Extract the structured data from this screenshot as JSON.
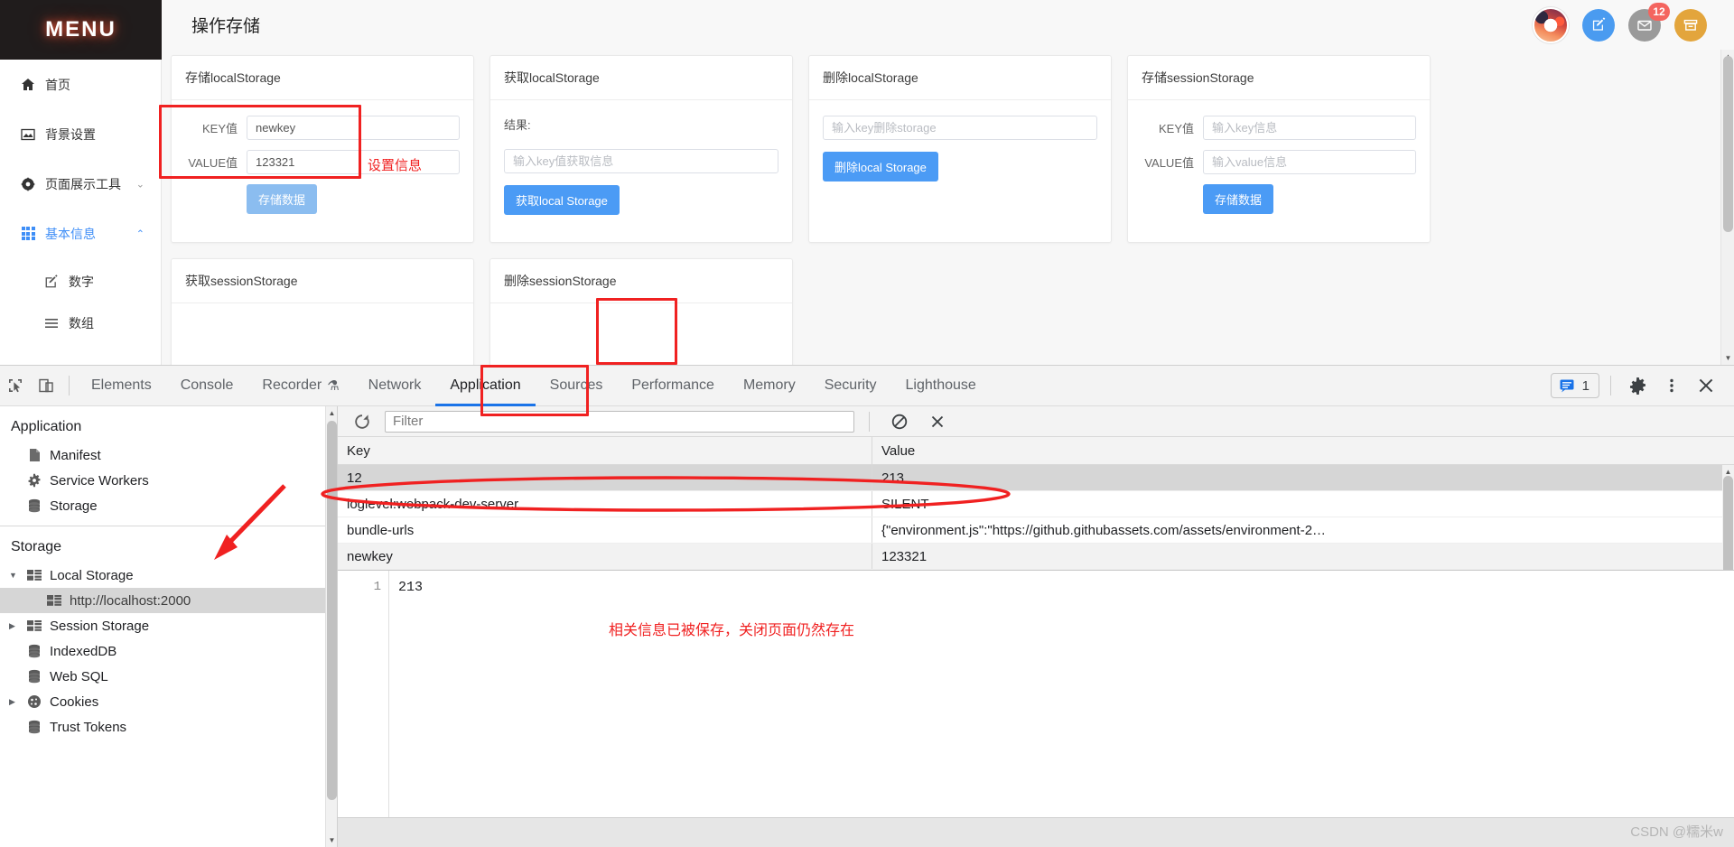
{
  "app": {
    "menu_label": "MENU",
    "page_title": "操作存储",
    "sidebar": [
      {
        "label": "首页",
        "icon": "home-icon",
        "kind": "top"
      },
      {
        "label": "背景设置",
        "icon": "image-icon",
        "kind": "top"
      },
      {
        "label": "页面展示工具",
        "icon": "compass-icon",
        "kind": "group",
        "caret": "⌄"
      },
      {
        "label": "基本信息",
        "icon": "grid-icon",
        "kind": "group-active",
        "caret": "⌃"
      },
      {
        "label": "数字",
        "icon": "edit-square-icon",
        "kind": "sub"
      },
      {
        "label": "数组",
        "icon": "list-icon",
        "kind": "sub"
      }
    ],
    "topbar_actions": [
      {
        "name": "avatar",
        "label": ""
      },
      {
        "name": "edit-button",
        "glyph": "✎",
        "color": "#4a9bf0"
      },
      {
        "name": "mail-button",
        "glyph": "✉",
        "color": "#9a9a9a",
        "badge": "12"
      },
      {
        "name": "archive-button",
        "glyph": "🗃",
        "color": "#e3a53c"
      }
    ],
    "cards": {
      "store_local": {
        "title": "存储localStorage",
        "key_label": "KEY值",
        "key_value": "newkey",
        "value_label": "VALUE值",
        "value_value": "123321",
        "submit_label": "存储数据"
      },
      "get_local": {
        "title": "获取localStorage",
        "result_label": "结果:",
        "input_placeholder": "输入key值获取信息",
        "submit_label": "获取local Storage"
      },
      "del_local": {
        "title": "删除localStorage",
        "input_placeholder": "输入key删除storage",
        "submit_label": "删除local Storage"
      },
      "store_session": {
        "title": "存储sessionStorage",
        "key_label": "KEY值",
        "key_placeholder": "输入key信息",
        "value_label": "VALUE值",
        "value_placeholder": "输入value信息",
        "submit_label": "存储数据"
      },
      "get_session": {
        "title": "获取sessionStorage"
      },
      "del_session": {
        "title": "删除sessionStorage"
      }
    },
    "annotation_set_info": "设置信息"
  },
  "devtools": {
    "tabs": [
      {
        "label": "Elements",
        "selected": false
      },
      {
        "label": "Console",
        "selected": false
      },
      {
        "label": "Recorder",
        "selected": false,
        "suffix": "⚗"
      },
      {
        "label": "Network",
        "selected": false
      },
      {
        "label": "Application",
        "selected": true
      },
      {
        "label": "Sources",
        "selected": false
      },
      {
        "label": "Performance",
        "selected": false
      },
      {
        "label": "Memory",
        "selected": false
      },
      {
        "label": "Security",
        "selected": false
      },
      {
        "label": "Lighthouse",
        "selected": false
      }
    ],
    "message_count": "1",
    "panel": {
      "application_title": "Application",
      "application_items": [
        {
          "label": "Manifest",
          "icon": "document-icon"
        },
        {
          "label": "Service Workers",
          "icon": "gear-icon"
        },
        {
          "label": "Storage",
          "icon": "database-icon"
        }
      ],
      "storage_title": "Storage",
      "storage_items": [
        {
          "label": "Local Storage",
          "icon": "table-icon",
          "twisty": "▼",
          "level": 1,
          "selected": false
        },
        {
          "label": "http://localhost:2000",
          "icon": "table-icon",
          "twisty": "",
          "level": 2,
          "selected": true
        },
        {
          "label": "Session Storage",
          "icon": "table-icon",
          "twisty": "▶",
          "level": 1,
          "selected": false
        },
        {
          "label": "IndexedDB",
          "icon": "database-icon",
          "twisty": "",
          "level": 1,
          "selected": false
        },
        {
          "label": "Web SQL",
          "icon": "database-icon",
          "twisty": "",
          "level": 1,
          "selected": false
        },
        {
          "label": "Cookies",
          "icon": "cookie-icon",
          "twisty": "▶",
          "level": 1,
          "selected": false
        },
        {
          "label": "Trust Tokens",
          "icon": "database-icon",
          "twisty": "",
          "level": 1,
          "selected": false
        }
      ]
    },
    "filter_placeholder": "Filter",
    "table": {
      "columns": [
        "Key",
        "Value"
      ],
      "rows": [
        {
          "key": "12",
          "value": "213",
          "selected": true
        },
        {
          "key": "loglevel:webpack-dev-server",
          "value": "SILENT",
          "selected": false
        },
        {
          "key": "bundle-urls",
          "value": "{\"environment.js\":\"https://github.githubassets.com/assets/environment-2…",
          "selected": false
        },
        {
          "key": "newkey",
          "value": "123321",
          "selected": false
        }
      ]
    },
    "preview": {
      "line_number": "1",
      "content": "213",
      "note": "相关信息已被保存，关闭页面仍然存在"
    }
  },
  "watermark": "CSDN @糯米w",
  "colors": {
    "accent_blue": "#4b9bf5",
    "annotation_red": "#f02121",
    "devtools_tab_underline": "#1a73e8",
    "badge_red": "#f4655f"
  }
}
